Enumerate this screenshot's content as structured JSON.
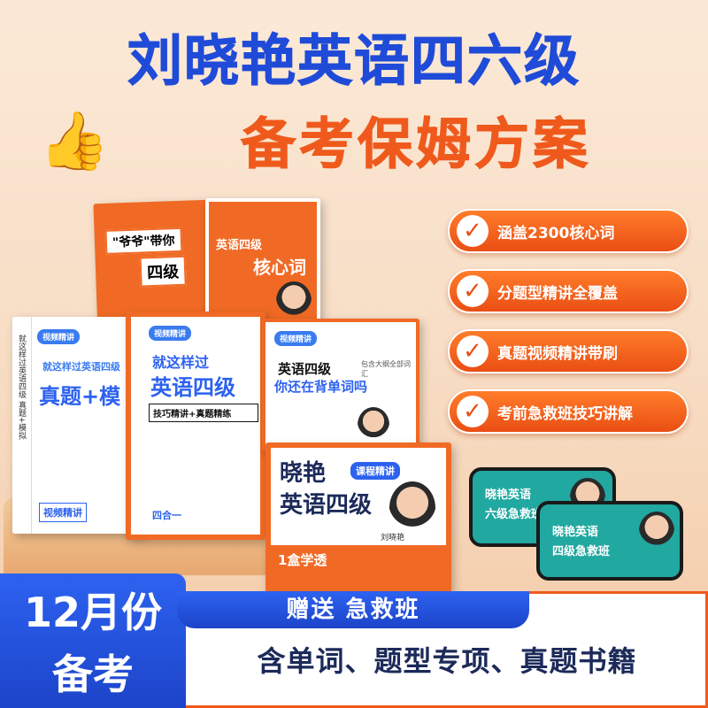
{
  "header": {
    "title_line1": "刘晓艳英语四六级",
    "title_line2": "备考保姆方案",
    "thumb_icon": "thumbs-up-icon"
  },
  "features": [
    {
      "label": "涵盖2300核心词"
    },
    {
      "label": "分题型精讲全覆盖"
    },
    {
      "label": "真题视频精讲带刷"
    },
    {
      "label": "考前急救班技巧讲解"
    }
  ],
  "books": {
    "book1": {
      "title_a": "\"爷爷\"带你",
      "title_b": "四级"
    },
    "book2": {
      "subtitle": "英语四级",
      "title": "核心词",
      "publisher": "刘晓艳"
    },
    "book3": {
      "tag": "视频精讲",
      "subtitle": "就这样过英语四级",
      "title": "真题+模",
      "badge": "视频精讲",
      "spine": "就这样过英语四级 真题+模拟"
    },
    "book4": {
      "tag": "视频精讲",
      "subtitle": "就这样过",
      "title": "英语四级",
      "band": "技巧精讲+真题精练",
      "footer": "四合一"
    },
    "book5": {
      "tag": "视频精讲",
      "subtitle": "英语四级",
      "title": "你还在背单词吗",
      "note": "包含大纲全部词汇"
    },
    "box": {
      "title_a": "晓艳",
      "title_b": "英语四级",
      "tag": "课程精讲",
      "footer": "1盒学透",
      "author": "刘晓艳"
    }
  },
  "phones": [
    {
      "line1": "晓艳英语",
      "line2": "六级急救班"
    },
    {
      "line1": "晓艳英语",
      "line2": "四级急救班"
    }
  ],
  "promo": {
    "month": "12月份",
    "prep": "备考",
    "bonus": "赠送 急救班",
    "includes": "含单词、题型专项、真题书籍"
  },
  "colors": {
    "blue": "#1f4bd8",
    "orange": "#ef5a1c",
    "teal": "#21a8a0"
  }
}
